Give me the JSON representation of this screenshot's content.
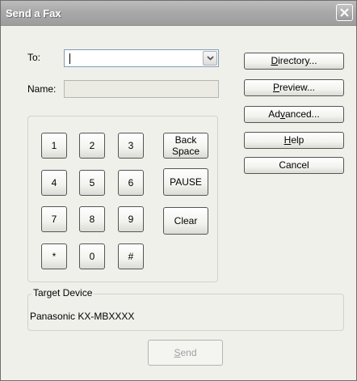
{
  "window": {
    "title": "Send a Fax"
  },
  "to": {
    "label": "To:",
    "value": ""
  },
  "name": {
    "label": "Name:",
    "value": ""
  },
  "actions": [
    {
      "label_pre": "",
      "accel": "D",
      "label_post": "irectory..."
    },
    {
      "label_pre": "",
      "accel": "P",
      "label_post": "review..."
    },
    {
      "label_pre": "Ad",
      "accel": "v",
      "label_post": "anced..."
    },
    {
      "label_pre": "",
      "accel": "H",
      "label_post": "elp"
    },
    {
      "label_pre": "Cancel",
      "accel": "",
      "label_post": ""
    }
  ],
  "keypad": {
    "keys": [
      "1",
      "2",
      "3",
      "4",
      "5",
      "6",
      "7",
      "8",
      "9",
      "*",
      "0",
      "#"
    ],
    "back_line1": "Back",
    "back_line2": "Space",
    "pause": "PAUSE",
    "clear": "Clear"
  },
  "target": {
    "title": "Target Device",
    "device": "Panasonic KX-MBXXXX"
  },
  "send": {
    "accel": "S",
    "label_post": "end",
    "enabled": false
  }
}
